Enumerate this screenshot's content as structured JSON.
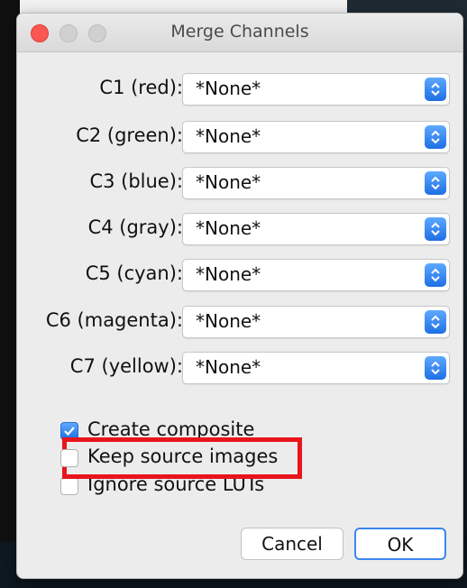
{
  "window": {
    "title": "Merge Channels"
  },
  "channels": [
    {
      "label": "C1 (red):",
      "value": "*None*"
    },
    {
      "label": "C2 (green):",
      "value": "*None*"
    },
    {
      "label": "C3 (blue):",
      "value": "*None*"
    },
    {
      "label": "C4 (gray):",
      "value": "*None*"
    },
    {
      "label": "C5 (cyan):",
      "value": "*None*"
    },
    {
      "label": "C6 (magenta):",
      "value": "*None*"
    },
    {
      "label": "C7 (yellow):",
      "value": "*None*"
    }
  ],
  "options": [
    {
      "label": "Create composite",
      "checked": true
    },
    {
      "label": "Keep source images",
      "checked": false
    },
    {
      "label": "Ignore source LUTs",
      "checked": false
    }
  ],
  "buttons": {
    "cancel": "Cancel",
    "ok": "OK"
  },
  "colors": {
    "accent": "#1e6fe5",
    "highlight": "#e8151b",
    "close": "#fc5753"
  }
}
